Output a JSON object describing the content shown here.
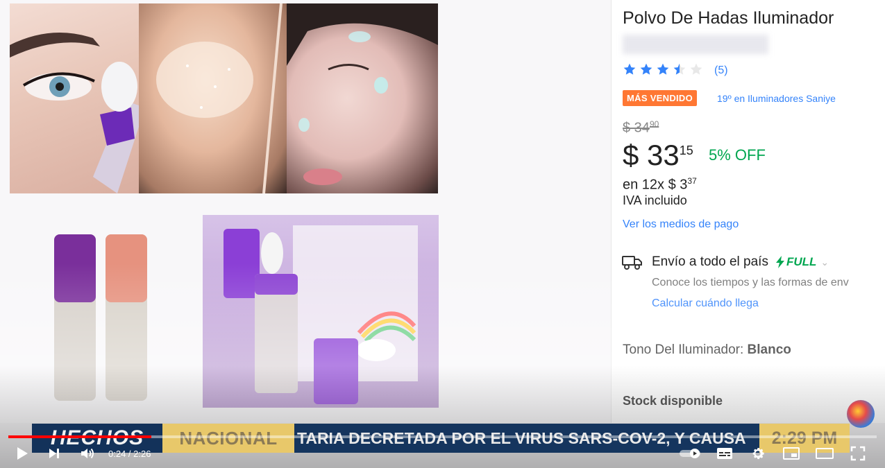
{
  "product": {
    "title": "Polvo De Hadas Iluminador",
    "rating": 3.5,
    "reviews": "(5)",
    "badge": "MÁS VENDIDO",
    "rank": "19º en Iluminadores Saniye",
    "old_price_int": "$ 34",
    "old_price_cents": "90",
    "price_int": "$ 33",
    "price_cents": "15",
    "discount": "5% OFF",
    "installments_prefix": "en 12x $ 3",
    "installments_cents": "37",
    "tax_note": "IVA incluido",
    "payment_link": "Ver los medios de pago",
    "shipping": {
      "text": "Envío a todo el país",
      "full_label": "FULL",
      "subtitle": "Conoce los tiempos y las formas de env",
      "link": "Calcular cuándo llega"
    },
    "tone_label": "Tono Del Iluminador:",
    "tone_value": "Blanco",
    "stock": "Stock disponible"
  },
  "ticker": {
    "brand": "HECHOS",
    "section": "NACIONAL",
    "headline": "TARIA DECRETADA POR EL VIRUS SARS-COV-2, Y CAUSA",
    "time": "2:29 PM"
  },
  "player": {
    "current_time": "0:24",
    "separator": " / ",
    "duration": "2:26",
    "progress_fraction": 0.165
  },
  "colors": {
    "accent_blue": "#3483fa",
    "badge_orange": "#ff7733",
    "green": "#00a650",
    "progress_red": "#ff0000"
  },
  "icons": {
    "play": "play-icon",
    "next": "next-icon",
    "volume": "volume-icon",
    "autoplay": "autoplay-toggle-icon",
    "captions": "captions-icon",
    "settings": "gear-icon",
    "miniplayer": "miniplayer-icon",
    "theater": "theater-icon",
    "fullscreen": "fullscreen-icon",
    "truck": "truck-icon",
    "bolt": "bolt-icon"
  }
}
